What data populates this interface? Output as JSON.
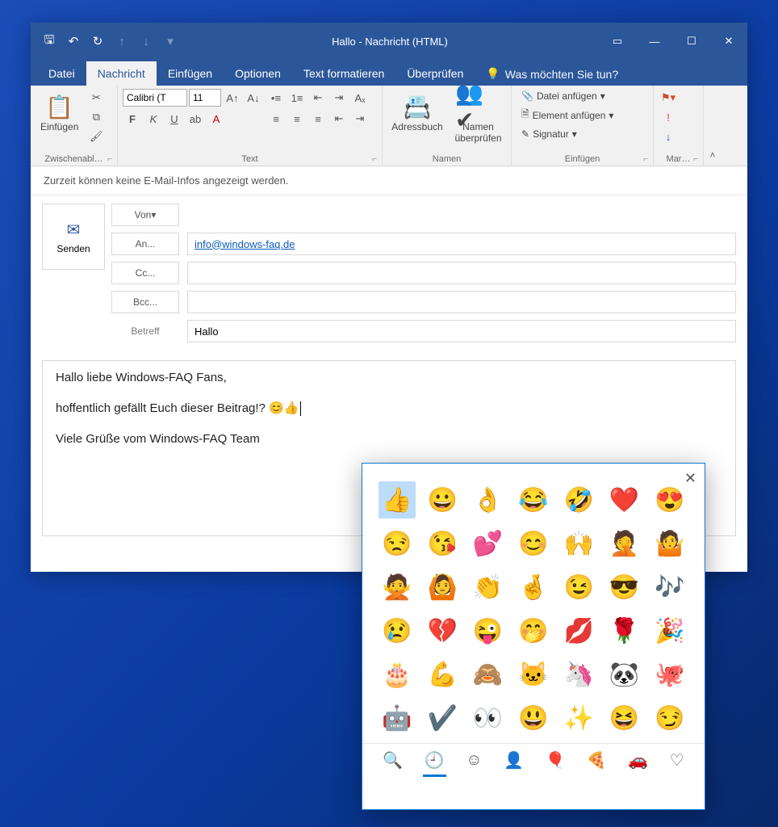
{
  "titlebar": {
    "title": "Hallo  -  Nachricht (HTML)"
  },
  "tabs": {
    "datei": "Datei",
    "nachricht": "Nachricht",
    "einfuegen": "Einfügen",
    "optionen": "Optionen",
    "text_formatieren": "Text formatieren",
    "ueberpruefen": "Überprüfen",
    "tellme": "Was möchten Sie tun?"
  },
  "ribbon": {
    "font_name": "Calibri (T",
    "font_size": "11",
    "paste_label": "Einfügen",
    "group_clipboard": "Zwischenabl…",
    "group_text": "Text",
    "group_names": "Namen",
    "group_insert": "Einfügen",
    "group_tags": "Mar…",
    "addressbook": "Adressbuch",
    "check_names_1": "Namen",
    "check_names_2": "überprüfen",
    "attach_file": "Datei anfügen",
    "attach_item": "Element anfügen",
    "signature": "Signatur"
  },
  "infobar": "Zurzeit können keine E-Mail-Infos angezeigt werden.",
  "compose": {
    "send": "Senden",
    "from_label": "Von",
    "from_value": "",
    "to_label": "An...",
    "to_value": "info@windows-faq.de",
    "cc_label": "Cc...",
    "cc_value": "",
    "bcc_label": "Bcc...",
    "bcc_value": "",
    "subject_label": "Betreff",
    "subject_value": "Hallo"
  },
  "body": {
    "line1": "Hallo liebe Windows-FAQ Fans,",
    "line2": "hoffentlich gefällt Euch dieser Beitrag!? 😊👍",
    "line3": "Viele Grüße vom Windows-FAQ Team"
  },
  "emoji": {
    "grid": [
      "👍",
      "😀",
      "👌",
      "😂",
      "🤣",
      "❤️",
      "😍",
      "😒",
      "😘",
      "💕",
      "😊",
      "🙌",
      "🤦",
      "🤷",
      "🙅",
      "🙆",
      "👏",
      "🤞",
      "😉",
      "😎",
      "🎶",
      "😢",
      "💔",
      "😜",
      "🤭",
      "💋",
      "🌹",
      "🎉",
      "🎂",
      "💪",
      "🙈",
      "🐱",
      "🦄",
      "🐼",
      "🐙",
      "🤖",
      "✔️",
      "👀",
      "😃",
      "✨",
      "😆",
      "😏"
    ],
    "selected_index": 0,
    "categories": [
      "search",
      "recent",
      "smileys",
      "people",
      "celebration",
      "food",
      "transport",
      "heart"
    ]
  }
}
